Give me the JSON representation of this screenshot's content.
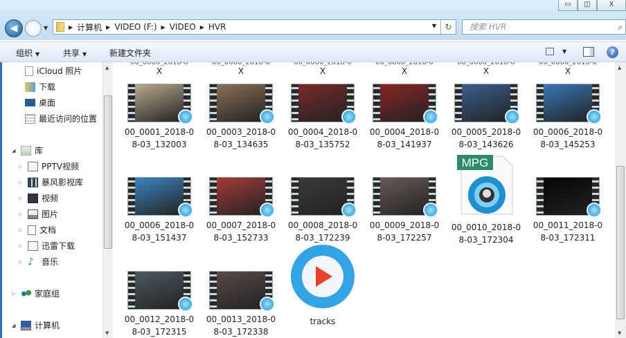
{
  "window": {
    "minimize": "▭",
    "maximize": "◫",
    "close": "X"
  },
  "nav": {
    "back_icon": "back-arrow-icon",
    "forward_icon": "forward-arrow-icon"
  },
  "address": {
    "crumbs": [
      "计算机",
      "VIDEO (F:)",
      "VIDEO",
      "HVR"
    ]
  },
  "search": {
    "placeholder": "搜索 HVR"
  },
  "toolbar": {
    "organize": "组织",
    "share": "共享",
    "new_folder": "新建文件夹"
  },
  "sidebar": {
    "favorites": [
      "iCloud 照片",
      "下载",
      "桌面",
      "最近访问的位置"
    ],
    "library": {
      "label": "库",
      "items": [
        "PPTV视频",
        "暴风影视库",
        "视频",
        "图片",
        "文档",
        "迅雷下载",
        "音乐"
      ]
    },
    "homegroup": "家庭组",
    "computer": "计算机"
  },
  "files": {
    "cut_row": [
      "X",
      "X",
      "X",
      "X",
      "X",
      "X"
    ],
    "items": [
      {
        "name": "00_0001_2018-08-03_132003",
        "tone": "#b9a98f"
      },
      {
        "name": "00_0003_2018-08-03_134635",
        "tone": "#8b6f5a"
      },
      {
        "name": "00_0004_2018-08-03_135752",
        "tone": "#7a2a2a"
      },
      {
        "name": "00_0004_2018-08-03_141937",
        "tone": "#8a2525"
      },
      {
        "name": "00_0005_2018-08-03_143626",
        "tone": "#3a5f8f"
      },
      {
        "name": "00_0006_2018-08-03_145253",
        "tone": "#3878b8"
      },
      {
        "name": "00_0006_2018-08-03_151437",
        "tone": "#3a86c0"
      },
      {
        "name": "00_0007_2018-08-03_152733",
        "tone": "#a63a3a"
      },
      {
        "name": "00_0008_2018-08-03_172239",
        "tone": "#3a3a3a"
      },
      {
        "name": "00_0009_2018-08-03_172257",
        "tone": "#6a5a55"
      },
      {
        "name": "00_0010_2018-08-03_172304",
        "tone": "mpg",
        "label": "MPG"
      },
      {
        "name": "00_0011_2018-08-03_172311",
        "tone": "#050505"
      },
      {
        "name": "00_0012_2018-08-03_172315",
        "tone": "#4b5a62"
      },
      {
        "name": "00_0013_2018-08-03_172338",
        "tone": "#5a4a48"
      },
      {
        "name": "tracks",
        "tone": "player"
      }
    ]
  }
}
